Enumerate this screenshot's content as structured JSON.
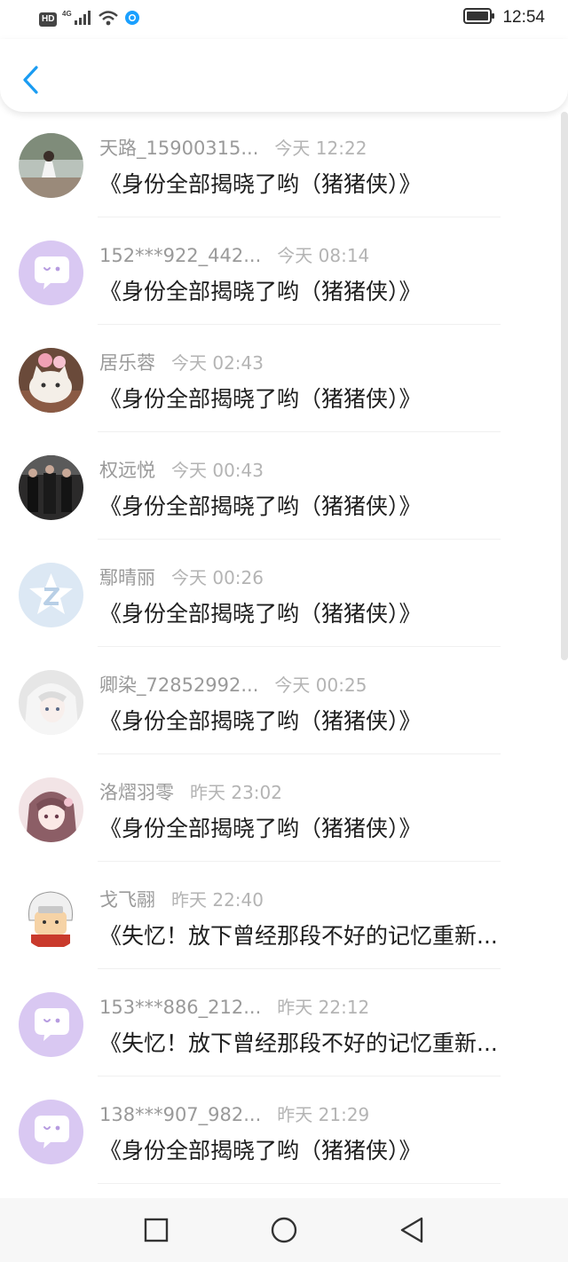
{
  "status_bar": {
    "hd_label": "HD",
    "network_label": "4G",
    "time": "12:54",
    "accent_color": "#1aa0ff"
  },
  "header": {
    "back_icon": "chevron-left-icon",
    "accent_color": "#1a9cf2"
  },
  "messages": [
    {
      "name": "天路_15900315...",
      "time": "今天 12:22",
      "text": "《身份全部揭晓了哟（猪猪侠）》",
      "avatar": "photo-girl-avatar",
      "truncated": true
    },
    {
      "name": "152***922_442...",
      "time": "今天 08:14",
      "text": "《身份全部揭晓了哟（猪猪侠）》",
      "avatar": "default-chat-avatar",
      "truncated": true
    },
    {
      "name": "居乐蓉",
      "time": "今天 02:43",
      "text": "《身份全部揭晓了哟（猪猪侠）》",
      "avatar": "cat-avatar",
      "truncated": false
    },
    {
      "name": "权远悦",
      "time": "今天 00:43",
      "text": "《身份全部揭晓了哟（猪猪侠）》",
      "avatar": "group-photo-avatar",
      "truncated": false
    },
    {
      "name": "鄢晴丽",
      "time": "今天 00:26",
      "text": "《身份全部揭晓了哟（猪猪侠）》",
      "avatar": "z-logo-avatar",
      "truncated": false
    },
    {
      "name": "卿染_72852992...",
      "time": "今天 00:25",
      "text": "《身份全部揭晓了哟（猪猪侠）》",
      "avatar": "anime-white-hair-avatar",
      "truncated": true
    },
    {
      "name": "洛熠羽零",
      "time": "昨天 23:02",
      "text": "《身份全部揭晓了哟（猪猪侠）》",
      "avatar": "anime-girl-avatar",
      "truncated": false
    },
    {
      "name": "戈飞翮",
      "time": "昨天 22:40",
      "text": "《失忆！放下曾经那段不好的记忆重新...",
      "avatar": "ninja-chibi-avatar",
      "truncated": false
    },
    {
      "name": "153***886_212...",
      "time": "昨天 22:12",
      "text": "《失忆！放下曾经那段不好的记忆重新...",
      "avatar": "default-chat-avatar",
      "truncated": true
    },
    {
      "name": "138***907_982...",
      "time": "昨天 21:29",
      "text": "《身份全部揭晓了哟（猪猪侠）》",
      "avatar": "default-chat-avatar",
      "truncated": true
    }
  ],
  "colors": {
    "default_avatar_bg": "#d9c8f2",
    "name_text": "#9a9a9a",
    "time_text": "#b4b4b4",
    "message_text": "#1e1e1e"
  },
  "nav": {
    "recents_icon": "square-icon",
    "home_icon": "circle-icon",
    "back_icon": "triangle-back-icon"
  }
}
